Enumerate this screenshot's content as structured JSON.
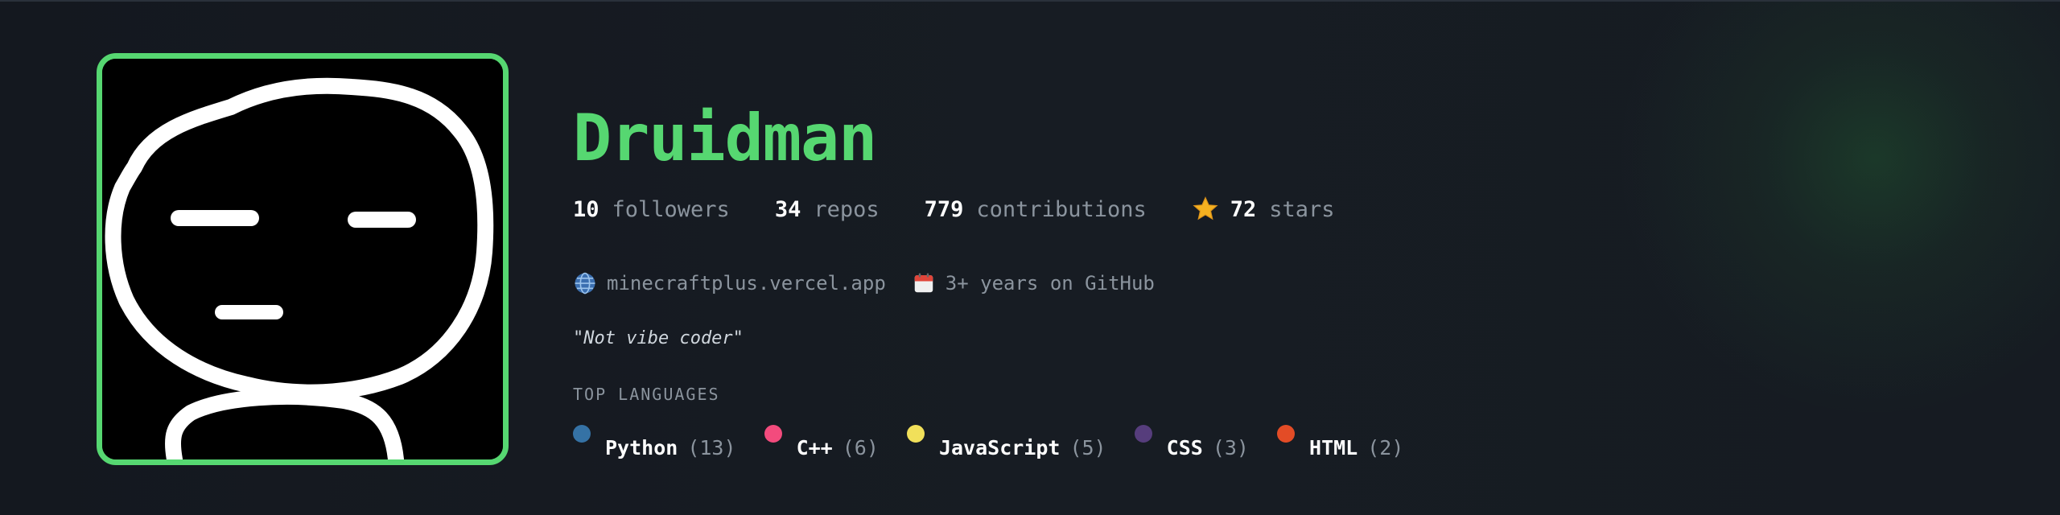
{
  "profile": {
    "name": "Druidman"
  },
  "stats": [
    {
      "value": "10",
      "label": "followers"
    },
    {
      "value": "34",
      "label": "repos"
    },
    {
      "value": "779",
      "label": "contributions"
    },
    {
      "value": "72",
      "label": "stars",
      "icon": "star-icon"
    }
  ],
  "meta": {
    "website": {
      "icon": "globe-icon",
      "text": "minecraftplus.vercel.app"
    },
    "age": {
      "icon": "calendar-icon",
      "text": "3+ years on GitHub"
    }
  },
  "bio": "\"Not vibe coder\"",
  "languages": {
    "title": "TOP LANGUAGES",
    "items": [
      {
        "name": "Python",
        "count": "(13)",
        "color": "#3572A5"
      },
      {
        "name": "C++",
        "count": "(6)",
        "color": "#f34b7d"
      },
      {
        "name": "JavaScript",
        "count": "(5)",
        "color": "#f1e05a"
      },
      {
        "name": "CSS",
        "count": "(3)",
        "color": "#563d7c"
      },
      {
        "name": "HTML",
        "count": "(2)",
        "color": "#e34c26"
      }
    ]
  },
  "colors": {
    "accent": "#56d771",
    "background": "#161b22"
  }
}
